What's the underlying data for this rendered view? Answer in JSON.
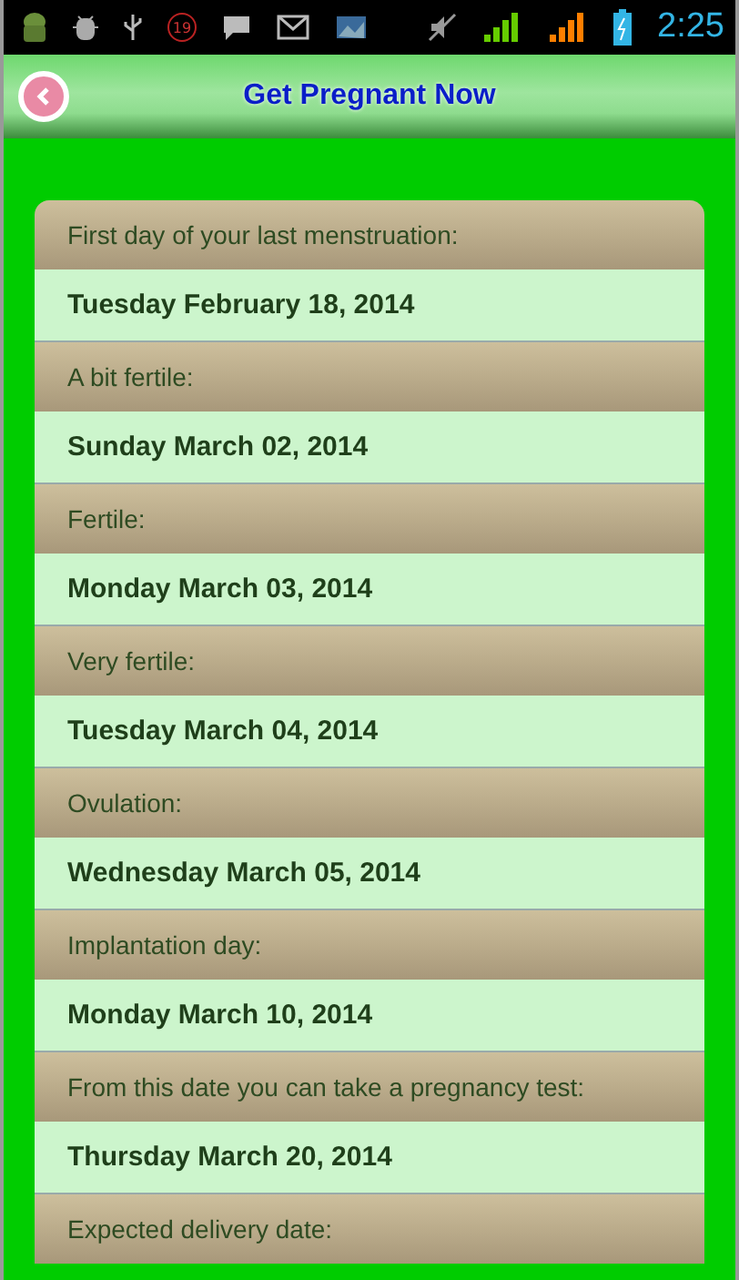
{
  "status_bar": {
    "notification_count": "19",
    "time": "2:25"
  },
  "app_bar": {
    "title": "Get Pregnant Now"
  },
  "dates": [
    {
      "label": "First day of your last menstruation:",
      "value": "Tuesday February 18, 2014"
    },
    {
      "label": "A bit fertile:",
      "value": "Sunday March 02, 2014"
    },
    {
      "label": "Fertile:",
      "value": "Monday March 03, 2014"
    },
    {
      "label": "Very fertile:",
      "value": "Tuesday March 04, 2014"
    },
    {
      "label": "Ovulation:",
      "value": "Wednesday March 05, 2014"
    },
    {
      "label": "Implantation day:",
      "value": "Monday March 10, 2014"
    },
    {
      "label": "From this date you can take a pregnancy test:",
      "value": "Thursday March 20, 2014"
    },
    {
      "label": "Expected delivery date:"
    }
  ]
}
